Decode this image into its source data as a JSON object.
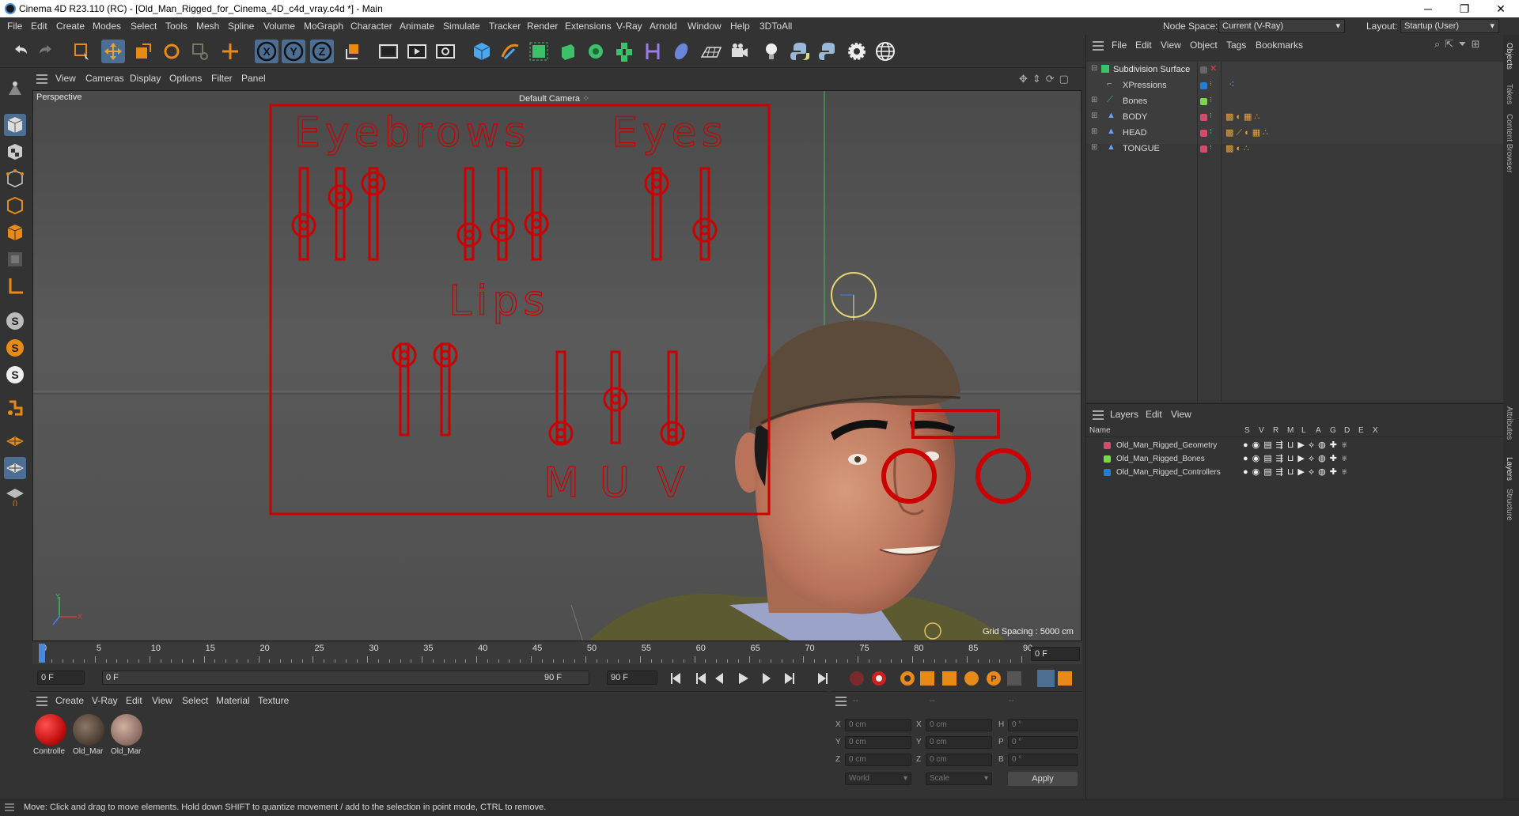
{
  "window": {
    "title": "Cinema 4D R23.110 (RC) - [Old_Man_Rigged_for_Cinema_4D_c4d_vray.c4d *] - Main",
    "minimize": "─",
    "maximize": "❐",
    "close": "✕"
  },
  "menubar": {
    "items": [
      "File",
      "Edit",
      "Create",
      "Modes",
      "Select",
      "Tools",
      "Mesh",
      "Spline",
      "Volume",
      "MoGraph",
      "Character",
      "Animate",
      "Simulate",
      "Tracker",
      "Render",
      "Extensions",
      "V-Ray",
      "Arnold",
      "Window",
      "Help",
      "3DToAll"
    ],
    "node_space_label": "Node Space:",
    "node_space_value": "Current (V-Ray)",
    "layout_label": "Layout:",
    "layout_value": "Startup (User)"
  },
  "viewport": {
    "menu": [
      "View",
      "Cameras",
      "Display",
      "Options",
      "Filter",
      "Panel"
    ],
    "view_name": "Perspective",
    "camera": "Default Camera",
    "grid_spacing": "Grid Spacing : 5000 cm",
    "axis_y": "Y",
    "axis_x": "X",
    "labels": {
      "eyebrows": "Eyebrows",
      "eyes": "Eyes",
      "lips": "Lips",
      "m": "M",
      "u": "U",
      "v": "V"
    },
    "colors": {
      "rig_red": "#cc0000",
      "bg": "#545454"
    }
  },
  "timeline": {
    "ticks": [
      "0",
      "5",
      "10",
      "15",
      "20",
      "25",
      "30",
      "35",
      "40",
      "45",
      "50",
      "55",
      "60",
      "65",
      "70",
      "75",
      "80",
      "85",
      "90"
    ],
    "current_frame": "0 F"
  },
  "transport": {
    "start": "0 F",
    "preview_start": "0 F",
    "preview_end": "90 F",
    "end": "90 F"
  },
  "material_manager": {
    "menu": [
      "Create",
      "V-Ray",
      "Edit",
      "View",
      "Select",
      "Material",
      "Texture"
    ],
    "materials": [
      {
        "name": "Controlle",
        "color": "#c41010"
      },
      {
        "name": "Old_Mar",
        "color": "#6b5a4a"
      },
      {
        "name": "Old_Mar",
        "color": "#a08070"
      }
    ]
  },
  "coords": {
    "header": [
      "--",
      "--",
      "--"
    ],
    "rows": [
      {
        "a": "X",
        "av": "0 cm",
        "b": "X",
        "bv": "0 cm",
        "c": "H",
        "cv": "0 °"
      },
      {
        "a": "Y",
        "av": "0 cm",
        "b": "Y",
        "bv": "0 cm",
        "c": "P",
        "cv": "0 °"
      },
      {
        "a": "Z",
        "av": "0 cm",
        "b": "Z",
        "bv": "0 cm",
        "c": "B",
        "cv": "0 °"
      }
    ],
    "world": "World",
    "scale": "Scale",
    "apply": "Apply"
  },
  "status": "Move: Click and drag to move elements. Hold down SHIFT to quantize movement / add to the selection in point mode, CTRL to remove.",
  "object_manager": {
    "menu": [
      "File",
      "Edit",
      "View",
      "Object",
      "Tags",
      "Bookmarks"
    ],
    "objects": [
      {
        "name": "Subdivision Surface",
        "color": "#888888"
      },
      {
        "name": "XPressions",
        "color": "#1e7fd4"
      },
      {
        "name": "Bones",
        "color": "#7ad94a"
      },
      {
        "name": "BODY",
        "color": "#d64a6a"
      },
      {
        "name": "HEAD",
        "color": "#d64a6a"
      },
      {
        "name": "TONGUE",
        "color": "#d64a6a"
      }
    ]
  },
  "layer_manager": {
    "menu": [
      "Layers",
      "Edit",
      "View"
    ],
    "col_name": "Name",
    "cols": [
      "S",
      "V",
      "R",
      "M",
      "L",
      "A",
      "G",
      "D",
      "E",
      "X"
    ],
    "layers": [
      {
        "name": "Old_Man_Rigged_Geometry",
        "color": "#d64a6a"
      },
      {
        "name": "Old_Man_Rigged_Bones",
        "color": "#7ad94a"
      },
      {
        "name": "Old_Man_Rigged_Controllers",
        "color": "#1e7fd4"
      }
    ]
  },
  "right_tabs": [
    "Objects",
    "Takes",
    "Content Browser",
    "Attributes",
    "Layers",
    "Structure"
  ]
}
